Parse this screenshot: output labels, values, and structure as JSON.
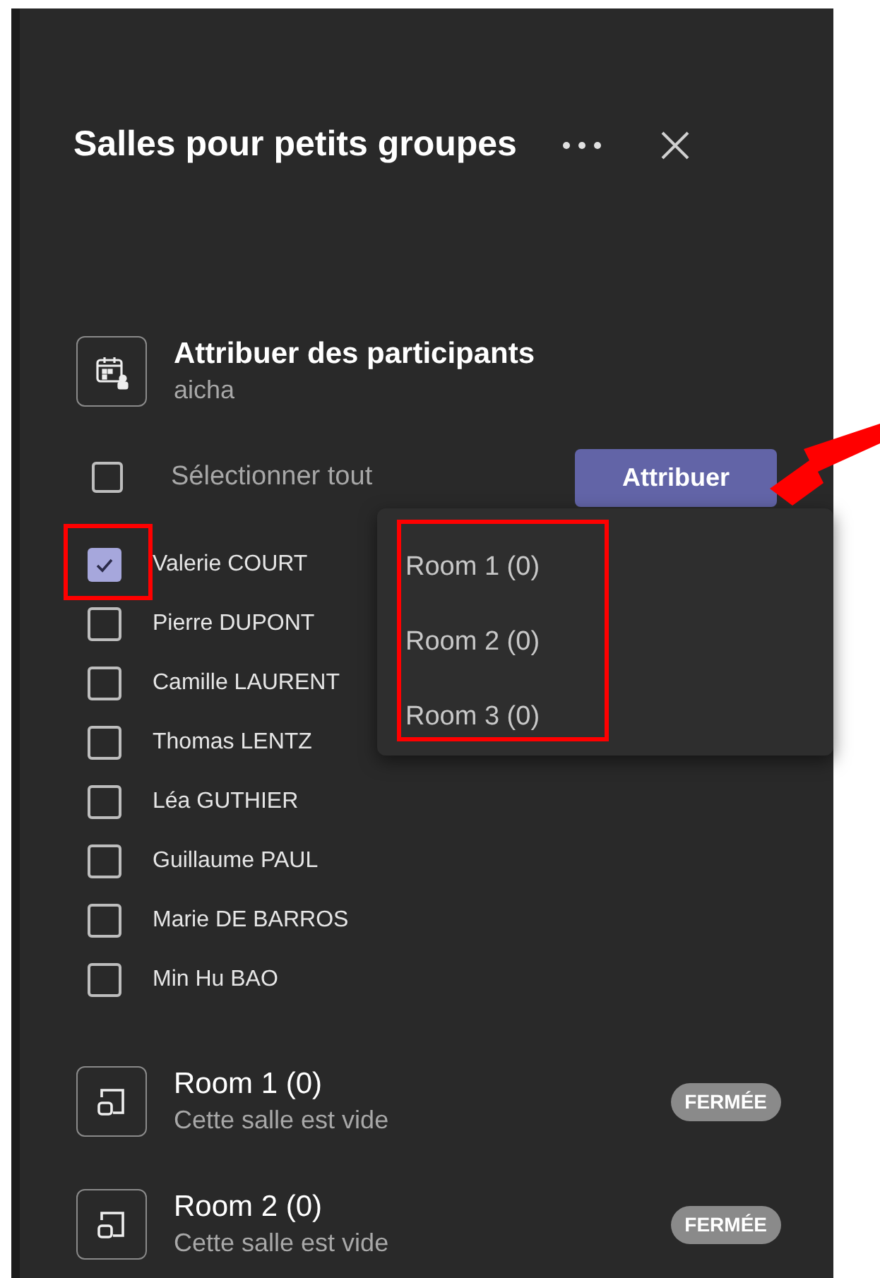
{
  "panel": {
    "title": "Salles pour petits groupes"
  },
  "assign": {
    "title": "Attribuer des participants",
    "subtitle": "aicha"
  },
  "select_all": {
    "label": "Sélectionner tout",
    "checked": false
  },
  "assign_button": {
    "label": "Attribuer",
    "highlighted": true
  },
  "participants": [
    {
      "name": "Valerie COURT",
      "checked": true,
      "highlighted": true
    },
    {
      "name": "Pierre DUPONT",
      "checked": false,
      "highlighted": false
    },
    {
      "name": "Camille LAURENT",
      "checked": false,
      "highlighted": false
    },
    {
      "name": "Thomas LENTZ",
      "checked": false,
      "highlighted": false
    },
    {
      "name": "Léa GUTHIER",
      "checked": false,
      "highlighted": false
    },
    {
      "name": "Guillaume PAUL",
      "checked": false,
      "highlighted": false
    },
    {
      "name": "Marie DE BARROS",
      "checked": false,
      "highlighted": false
    },
    {
      "name": "Min Hu BAO",
      "checked": false,
      "highlighted": false
    }
  ],
  "room_menu": {
    "highlighted": true,
    "items": [
      "Room 1 (0)",
      "Room 2 (0)",
      "Room 3 (0)"
    ]
  },
  "rooms": [
    {
      "name": "Room 1 (0)",
      "status": "Cette salle est vide",
      "badge": "FERMÉE"
    },
    {
      "name": "Room 2 (0)",
      "status": "Cette salle est vide",
      "badge": "FERMÉE"
    }
  ]
}
